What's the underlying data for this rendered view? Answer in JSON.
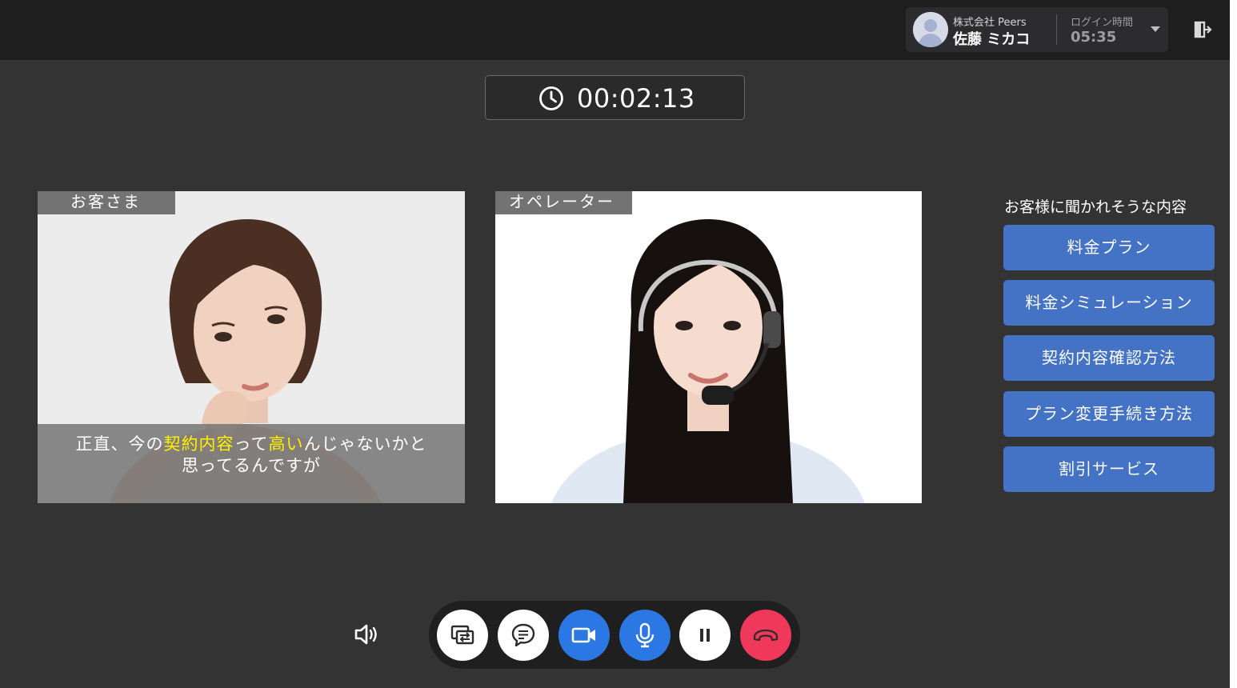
{
  "header": {
    "company": "株式会社 Peers",
    "user_name": "佐藤 ミカコ",
    "login_label": "ログイン時間",
    "login_time": "05:35"
  },
  "timer": {
    "elapsed": "00:02:13"
  },
  "customer_video": {
    "tag": "お客さま",
    "caption": {
      "line1_parts": [
        "正直、今の",
        "契約内容",
        "って",
        "高い",
        "んじゃないかと"
      ],
      "line2": "思ってるんですが"
    }
  },
  "operator_video": {
    "tag": "オペレーター"
  },
  "suggestions": {
    "title": "お客様に聞かれそうな内容",
    "items": [
      {
        "label": "料金プラン"
      },
      {
        "label": "料金シミュレーション"
      },
      {
        "label": "契約内容確認方法"
      },
      {
        "label": "プラン変更手続き方法"
      },
      {
        "label": "割引サービス"
      }
    ]
  },
  "controls": [
    {
      "icon": "screen-share-icon",
      "style": "white"
    },
    {
      "icon": "chat-icon",
      "style": "white"
    },
    {
      "icon": "video-camera-icon",
      "style": "blue"
    },
    {
      "icon": "microphone-icon",
      "style": "blue"
    },
    {
      "icon": "pause-icon",
      "style": "white"
    },
    {
      "icon": "hang-up-icon",
      "style": "red"
    }
  ],
  "colors": {
    "accent_blue": "#4472c4",
    "control_blue": "#2b78e4",
    "hangup_red": "#f0385a",
    "caption_highlight": "#fff200"
  }
}
